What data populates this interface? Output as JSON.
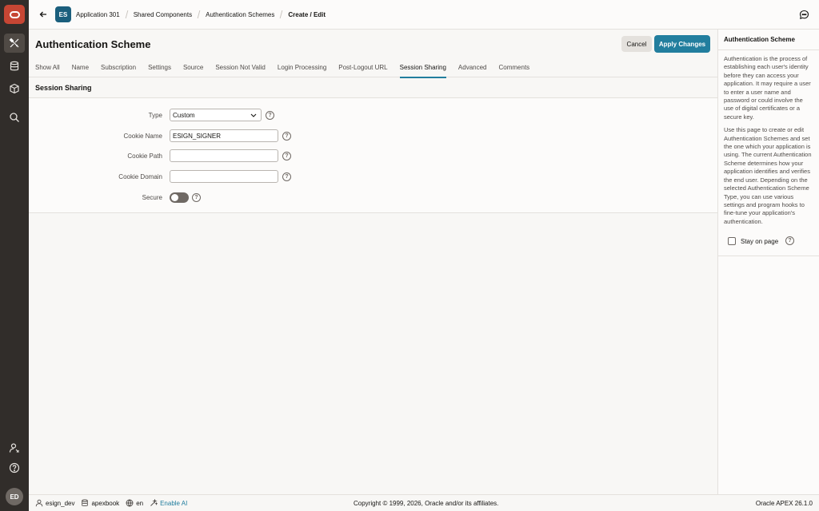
{
  "rail": {
    "items": [
      "app-builder-icon",
      "sql-workshop-icon",
      "gallery-icon",
      "search-icon"
    ],
    "bottom": [
      "admin-icon",
      "help-icon"
    ],
    "avatar": "ED"
  },
  "header": {
    "app_badge": "ES",
    "breadcrumbs": [
      "Application 301",
      "Shared Components",
      "Authentication Schemes",
      "Create / Edit"
    ]
  },
  "page": {
    "title": "Authentication Scheme",
    "cancel_label": "Cancel",
    "apply_label": "Apply Changes"
  },
  "tabs": [
    "Show All",
    "Name",
    "Subscription",
    "Settings",
    "Source",
    "Session Not Valid",
    "Login Processing",
    "Post-Logout URL",
    "Session Sharing",
    "Advanced",
    "Comments"
  ],
  "active_tab": "Session Sharing",
  "region": {
    "title": "Session Sharing",
    "fields": {
      "type_label": "Type",
      "type_value": "Custom",
      "cookie_name_label": "Cookie Name",
      "cookie_name_value": "ESIGN_SIGNER",
      "cookie_path_label": "Cookie Path",
      "cookie_path_value": "",
      "cookie_domain_label": "Cookie Domain",
      "cookie_domain_value": "",
      "secure_label": "Secure",
      "secure_on": false
    }
  },
  "help_panel": {
    "title": "Authentication Scheme",
    "paragraphs": [
      "Authentication is the process of establishing each user's identity before they can access your application. It may require a user to enter a user name and password or could involve the use of digital certificates or a secure key.",
      "Use this page to create or edit Authentication Schemes and set the one which your application is using. The current Authentication Scheme determines how your application identifies and verifies the end user. Depending on the selected Authentication Scheme Type, you can use various settings and program hooks to fine-tune your application's authentication."
    ],
    "stay_label": "Stay on page"
  },
  "footer": {
    "user": "esign_dev",
    "workspace": "apexbook",
    "language": "en",
    "ai_label": "Enable AI",
    "copyright": "Copyright © 1999, 2026, Oracle and/or its affiliates.",
    "version": "Oracle APEX 26.1.0"
  },
  "colors": {
    "accent": "#227e9e",
    "rail": "#312d2a",
    "oracle_red": "#c74634"
  }
}
